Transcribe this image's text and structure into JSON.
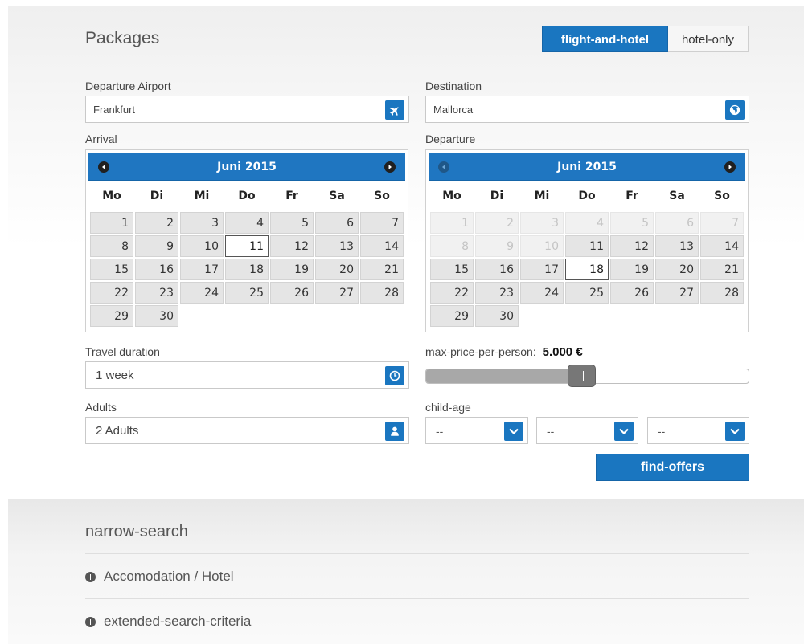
{
  "header": {
    "title": "Packages"
  },
  "tabs": [
    {
      "label": "flight-and-hotel",
      "active": true
    },
    {
      "label": "hotel-only",
      "active": false
    }
  ],
  "departure_airport": {
    "label": "Departure Airport",
    "value": "Frankfurt",
    "icon": "airplane-icon"
  },
  "destination": {
    "label": "Destination",
    "value": "Mallorca",
    "icon": "globe-icon"
  },
  "weekdays": [
    "Mo",
    "Di",
    "Mi",
    "Do",
    "Fr",
    "Sa",
    "So"
  ],
  "arrival": {
    "label": "Arrival",
    "month": "Juni 2015",
    "selected_day": 11,
    "disabled_before": 0,
    "prev_enabled": true,
    "days": [
      "1",
      "2",
      "3",
      "4",
      "5",
      "6",
      "7",
      "8",
      "9",
      "10",
      "11",
      "12",
      "13",
      "14",
      "15",
      "16",
      "17",
      "18",
      "19",
      "20",
      "21",
      "22",
      "23",
      "24",
      "25",
      "26",
      "27",
      "28",
      "29",
      "30"
    ]
  },
  "departure": {
    "label": "Departure",
    "month": "Juni 2015",
    "selected_day": 18,
    "disabled_before": 11,
    "prev_enabled": false,
    "days": [
      "1",
      "2",
      "3",
      "4",
      "5",
      "6",
      "7",
      "8",
      "9",
      "10",
      "11",
      "12",
      "13",
      "14",
      "15",
      "16",
      "17",
      "18",
      "19",
      "20",
      "21",
      "22",
      "23",
      "24",
      "25",
      "26",
      "27",
      "28",
      "29",
      "30"
    ]
  },
  "travel_duration": {
    "label": "Travel duration",
    "value": "1 week",
    "icon": "clock-icon"
  },
  "adults": {
    "label": "Adults",
    "value": "2 Adults",
    "icon": "person-icon"
  },
  "max_price": {
    "label": "max-price-per-person:",
    "value": "5.000 €",
    "level_percent": 48
  },
  "child_age": {
    "label": "child-age",
    "selects": [
      "--",
      "--",
      "--"
    ]
  },
  "find_offers": {
    "label": "find-offers"
  },
  "narrow_search": {
    "title": "narrow-search",
    "items": [
      "Accomodation / Hotel",
      "extended-search-criteria"
    ]
  },
  "colors": {
    "accent": "#1a76c0",
    "calendar_header": "#1f76c1"
  }
}
